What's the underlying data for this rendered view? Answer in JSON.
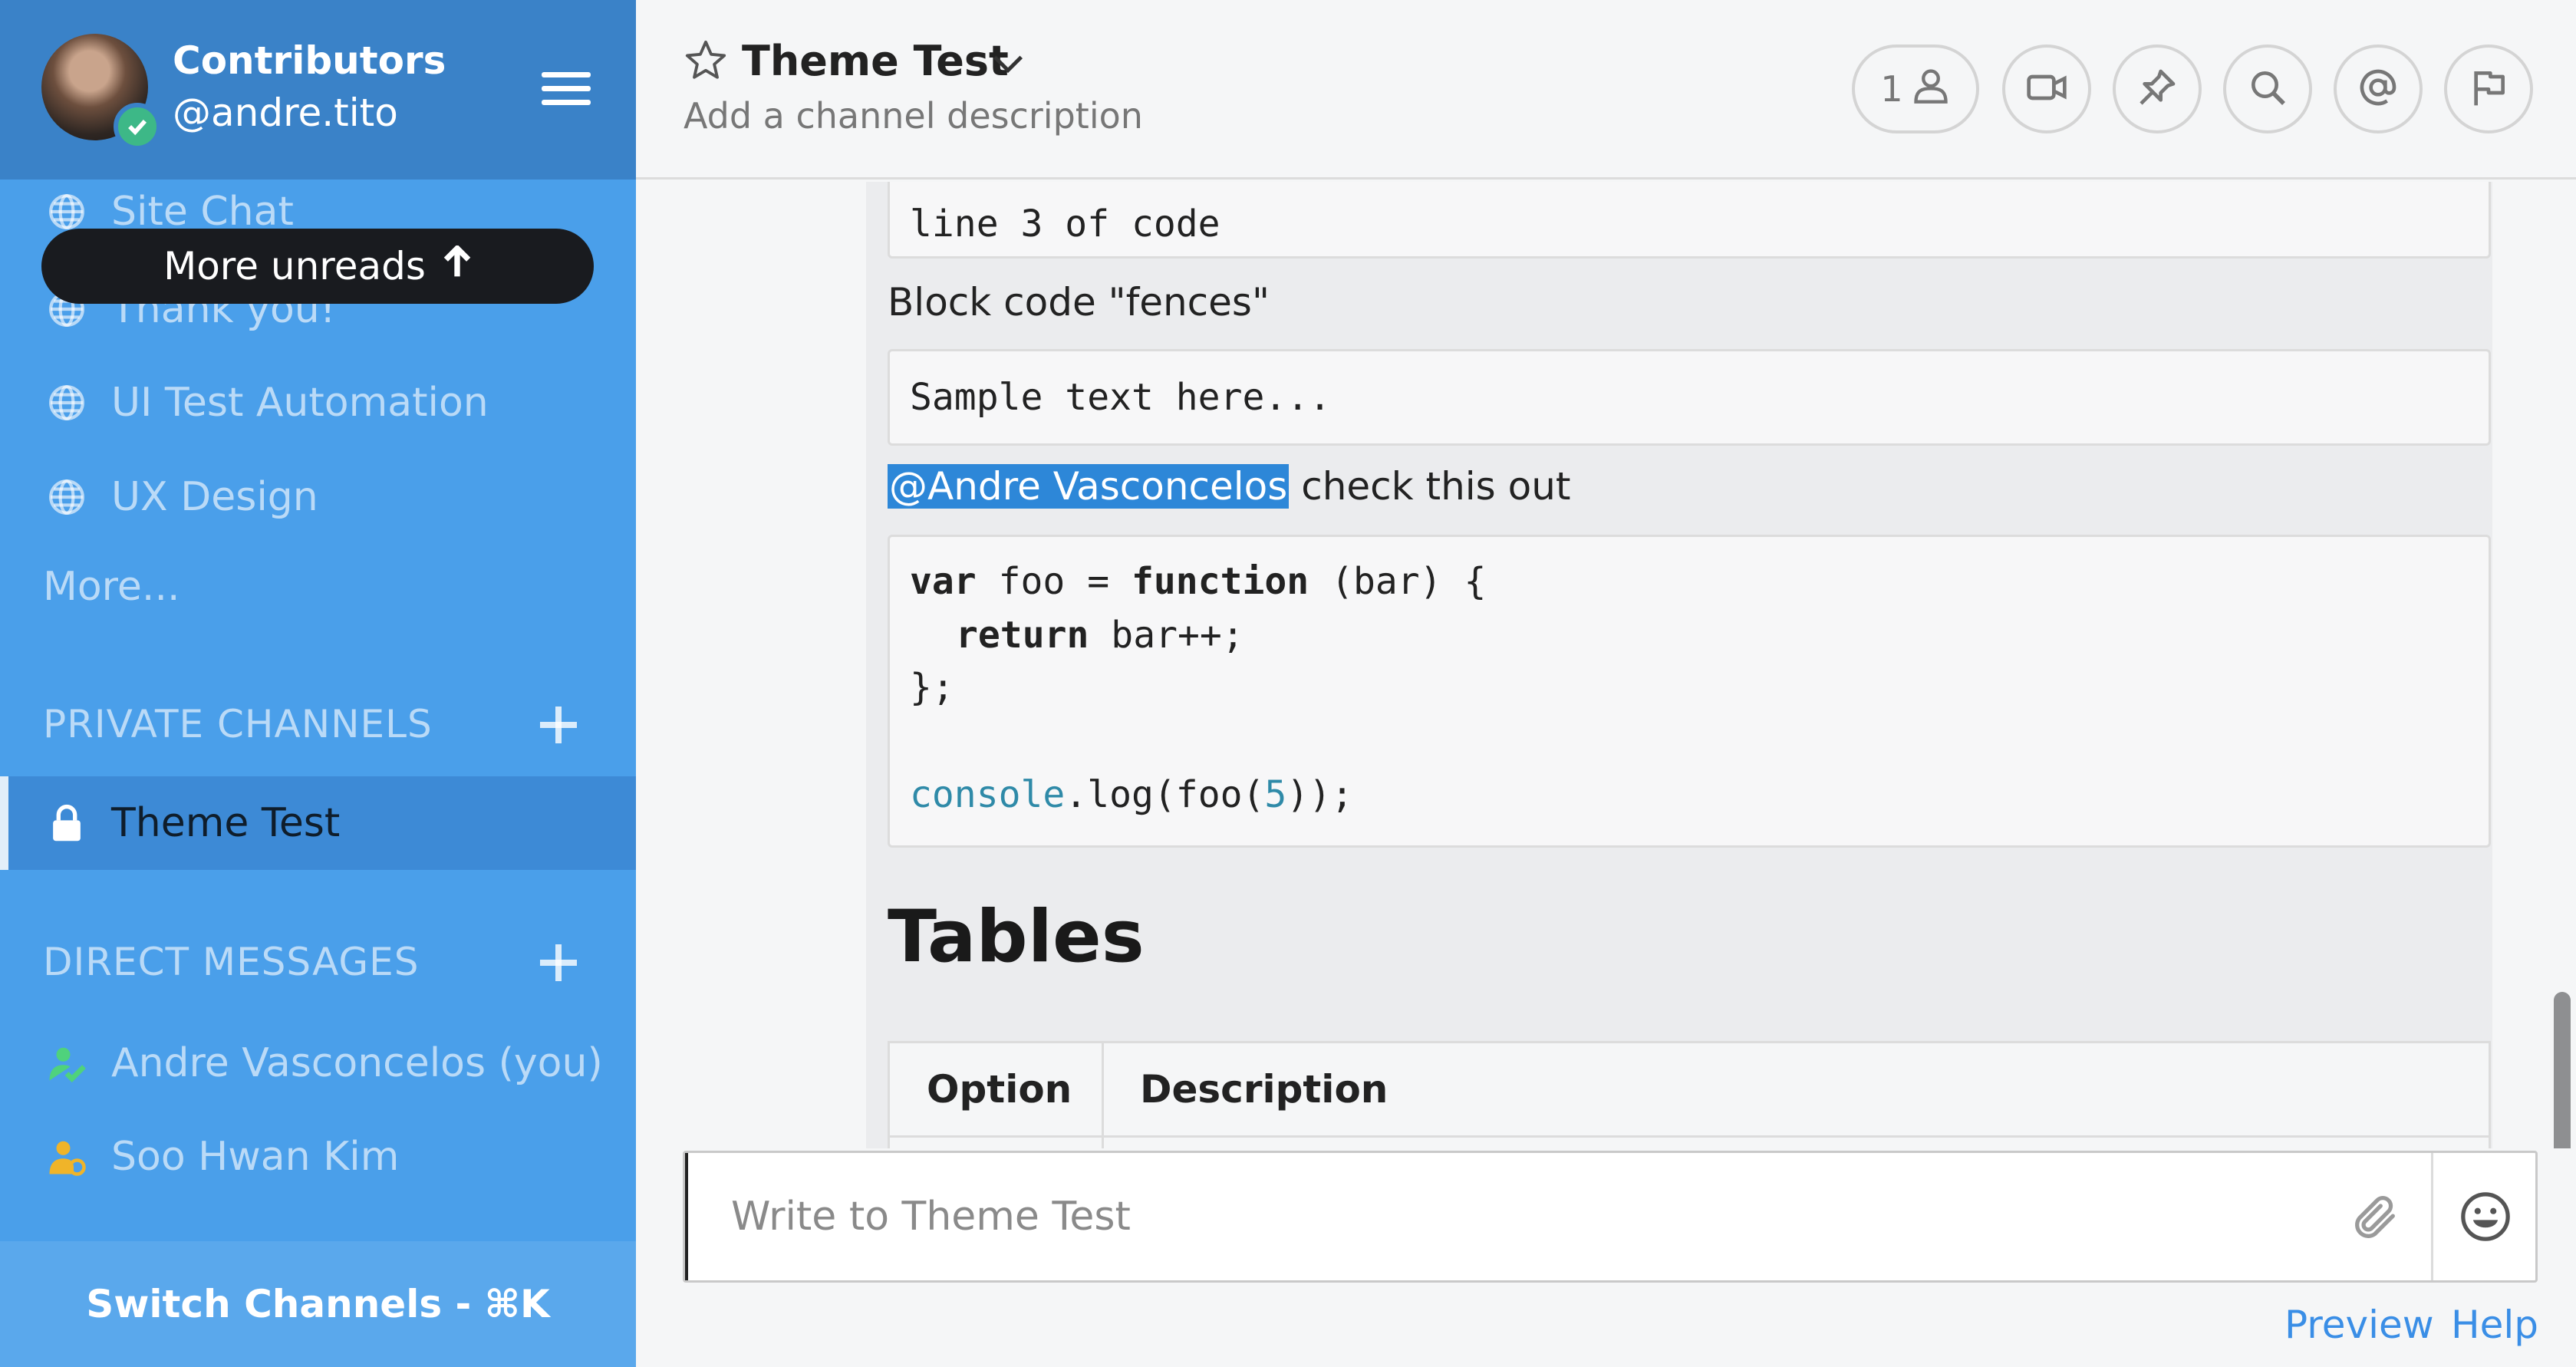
{
  "team": {
    "name": "Contributors",
    "handle": "@andre.tito"
  },
  "sidebar": {
    "channels": [
      {
        "label": "Site Chat",
        "icon": "globe-icon"
      },
      {
        "label": "Thank you!",
        "icon": "globe-icon"
      },
      {
        "label": "UI Test Automation",
        "icon": "globe-icon"
      },
      {
        "label": "UX Design",
        "icon": "globe-icon"
      }
    ],
    "more_label": "More...",
    "more_unreads": "More unreads",
    "private_header": "PRIVATE CHANNELS",
    "private_channels": [
      {
        "label": "Theme Test",
        "icon": "lock-icon",
        "active": true
      }
    ],
    "dm_header": "DIRECT MESSAGES",
    "direct_messages": [
      {
        "label": "Andre Vasconcelos (you)",
        "status": "online",
        "status_color": "#4fd27c"
      },
      {
        "label": "Soo Hwan Kim",
        "status": "away",
        "status_color": "#f0b429"
      }
    ],
    "switch_channels": "Switch Channels - ⌘K"
  },
  "header": {
    "title": "Theme Test",
    "description": "Add a channel description",
    "member_count": "1",
    "buttons": [
      "video-icon",
      "pin-icon",
      "search-icon",
      "at-icon",
      "flag-icon"
    ]
  },
  "post": {
    "code_line_3": "line 3 of code",
    "fences_label": "Block code \"fences\"",
    "fences_sample": "Sample text here...",
    "mention": "@Andre Vasconcelos",
    "mention_rest": " check this out",
    "code": {
      "kw_var": "var",
      "foo_eq": " foo = ",
      "kw_function": "function",
      "bar_sig": " (bar) {",
      "kw_return": "return",
      "bar_inc": " bar++;",
      "close": "};",
      "console": "console",
      "log_call": ".log(foo(",
      "arg": "5",
      "log_end": "));"
    },
    "tables_heading": "Tables",
    "table_headers": [
      "Option",
      "Description"
    ]
  },
  "composer": {
    "placeholder": "Write to Theme Test"
  },
  "footer": {
    "preview": "Preview",
    "help": "Help"
  },
  "colors": {
    "sidebar_bg": "#4a9fea",
    "header_bg": "#3a82c8",
    "mention_bg": "#2d87d8",
    "link": "#3a8ee6"
  }
}
